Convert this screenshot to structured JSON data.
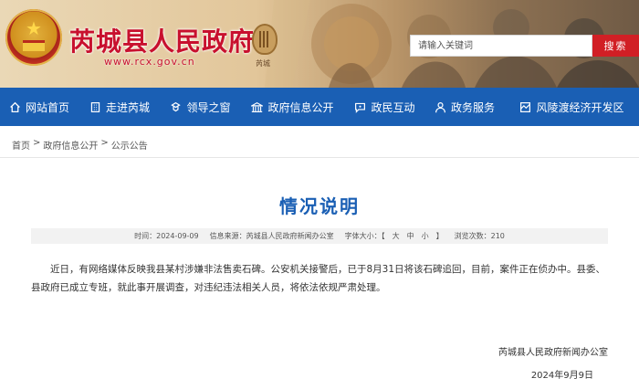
{
  "header": {
    "site_title": "芮城县人民政府",
    "site_url": "www.rcx.gov.cn",
    "search_placeholder": "请输入关键词",
    "search_button": "搜索"
  },
  "nav": [
    {
      "label": "网站首页",
      "icon": "home-icon"
    },
    {
      "label": "走进芮城",
      "icon": "building-icon"
    },
    {
      "label": "领导之窗",
      "icon": "leader-icon"
    },
    {
      "label": "政府信息公开",
      "icon": "gov-building-icon"
    },
    {
      "label": "政民互动",
      "icon": "chat-icon"
    },
    {
      "label": "政务服务",
      "icon": "service-icon"
    },
    {
      "label": "风陵渡经济开发区",
      "icon": "development-zone-icon"
    }
  ],
  "breadcrumb": [
    "首页",
    "政府信息公开",
    "公示公告"
  ],
  "breadcrumb_separator": ">",
  "article": {
    "title": "情况说明",
    "meta": {
      "time": "时间：2024-09-09",
      "source": "信息来源：芮城县人民政府新闻办公室",
      "font_size_label": "字体大小：【",
      "font_large": "大",
      "font_medium": "中",
      "font_small": "小",
      "font_size_end": "】",
      "views": "浏览次数：210"
    },
    "body": "近日，有网络媒体反映我县某村涉嫌非法售卖石碑。公安机关接警后，已于8月31日将该石碑追回，目前，案件正在侦办中。县委、县政府已成立专班，就此事开展调查，对违纪违法相关人员，将依法依规严肃处理。",
    "signature": "芮城县人民政府新闻办公室",
    "date": "2024年9月9日"
  },
  "colors": {
    "nav_bg": "#1a5fb4",
    "title_red": "#c8102e",
    "search_button": "#d11f25",
    "article_title": "#1a5fb4"
  }
}
